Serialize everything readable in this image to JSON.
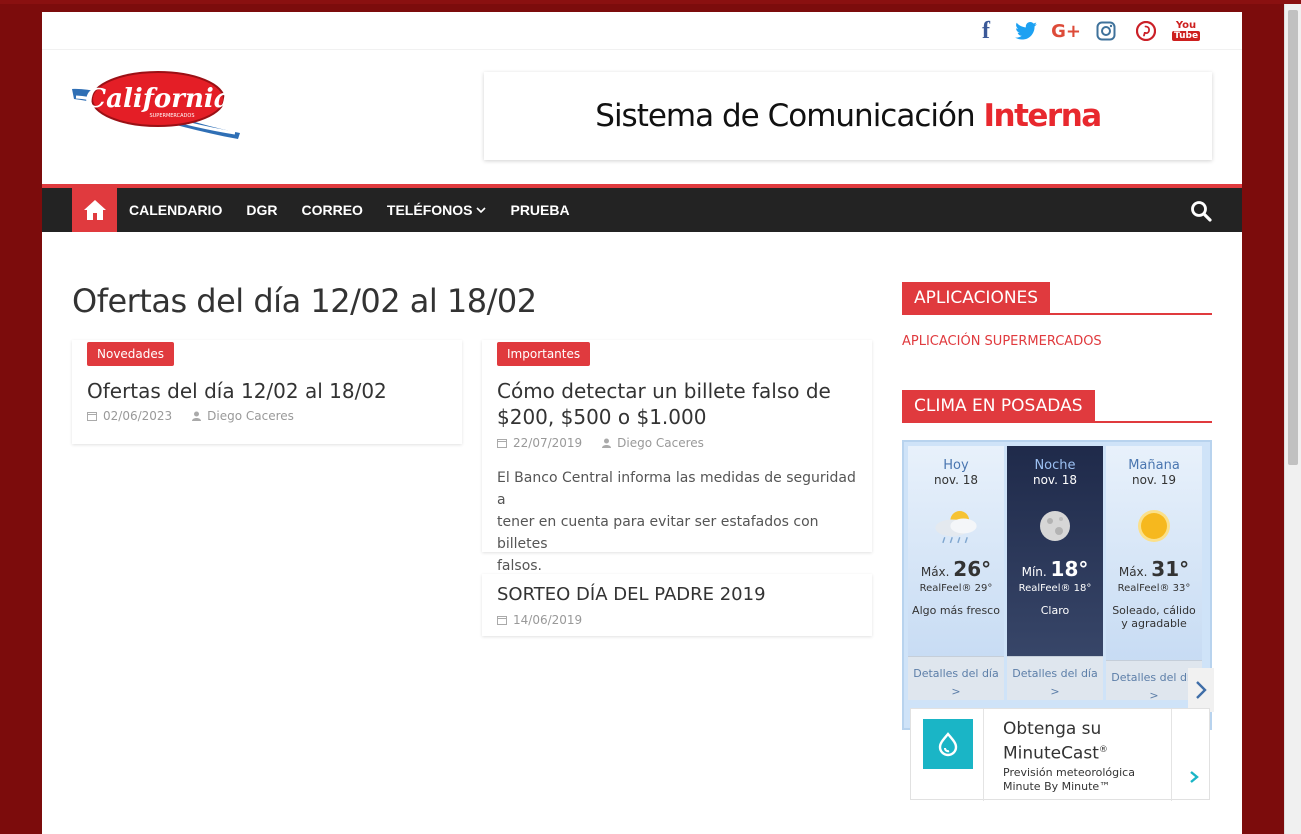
{
  "social": {
    "facebook_glyph": "f",
    "google_plus_glyph": "G+",
    "youtube_glyph_top": "You",
    "youtube_glyph_bottom": "Tube"
  },
  "header": {
    "logo_alt": "California",
    "logo_sub": "SUPERMERCADOS",
    "banner_text": "Sistema de Comunicación",
    "banner_accent": "Interna"
  },
  "nav": {
    "items": [
      {
        "label": "CALENDARIO"
      },
      {
        "label": "DGR"
      },
      {
        "label": "CORREO"
      },
      {
        "label": "TELÉFONOS"
      },
      {
        "label": "PRUEBA"
      }
    ]
  },
  "main": {
    "page_title": "Ofertas del día 12/02 al 18/02",
    "posts": [
      {
        "badge": "Novedades",
        "title": "Ofertas del día 12/02 al 18/02",
        "date": "02/06/2023",
        "author": "Diego Caceres"
      },
      {
        "badge": "Importantes",
        "title_line1": "Cómo detectar un billete falso de",
        "title_line2": "$200, $500 o $1.000",
        "date": "22/07/2019",
        "author": "Diego Caceres",
        "excerpt_line1": "El Banco Central informa las medidas de seguridad a",
        "excerpt_line2": "tener en cuenta para evitar ser estafados con billetes",
        "excerpt_line3": "falsos."
      },
      {
        "title": "SORTEO DÍA DEL PADRE 2019",
        "date": "14/06/2019"
      }
    ]
  },
  "sidebar": {
    "apps_title": "APLICACIONES",
    "apps_link": "APLICACIÓN SUPERMERCADOS",
    "weather_title": "CLIMA EN POSADAS",
    "weather": [
      {
        "label": "Hoy",
        "date": "nov. 18",
        "prefix": "Máx.",
        "temp": "26°",
        "realfeel": "RealFeel® 29°",
        "desc_line1": "Algo más fresco",
        "desc_line2": "",
        "details": "Detalles del día",
        "details_arrow": ">"
      },
      {
        "label": "Noche",
        "date": "nov. 18",
        "prefix": "Mín.",
        "temp": "18°",
        "realfeel": "RealFeel® 18°",
        "desc_line1": "Claro",
        "desc_line2": "",
        "details": "Detalles del día",
        "details_arrow": ">"
      },
      {
        "label": "Mañana",
        "date": "nov. 19",
        "prefix": "Máx.",
        "temp": "31°",
        "realfeel": "RealFeel® 33°",
        "desc_line1": "Soleado, cálido",
        "desc_line2": "y agradable",
        "details": "Detalles del día >",
        "details_arrow": ""
      }
    ],
    "minutecast": {
      "title_line1": "Obtenga su",
      "title_line2": "MinuteCast",
      "title_mark": "®",
      "sub_line1": "Previsión meteorológica",
      "sub_line2": "Minute By Minute™"
    }
  }
}
